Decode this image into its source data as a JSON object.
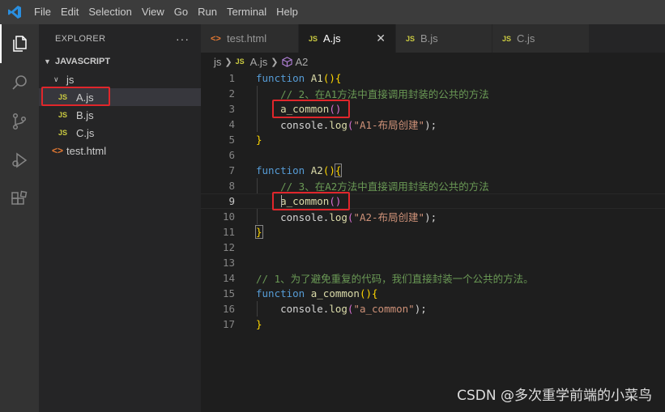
{
  "menu": [
    "File",
    "Edit",
    "Selection",
    "View",
    "Go",
    "Run",
    "Terminal",
    "Help"
  ],
  "sidebar": {
    "title": "EXPLORER",
    "more": "···",
    "root": "JAVASCRIPT",
    "folder": "js",
    "files": [
      {
        "badge": "JS",
        "name": "A.js"
      },
      {
        "badge": "JS",
        "name": "B.js"
      },
      {
        "badge": "JS",
        "name": "C.js"
      }
    ],
    "html_file": {
      "badge": "<>",
      "name": "test.html"
    }
  },
  "tabs": [
    {
      "badge": "<>",
      "name": "test.html"
    },
    {
      "badge": "JS",
      "name": "A.js",
      "close": "✕"
    },
    {
      "badge": "JS",
      "name": "B.js"
    },
    {
      "badge": "JS",
      "name": "C.js"
    }
  ],
  "breadcrumb": {
    "folder": "js",
    "file_badge": "JS",
    "file": "A.js",
    "symbol": "A2"
  },
  "code_lines": [
    {
      "n": "1"
    },
    {
      "n": "2"
    },
    {
      "n": "3"
    },
    {
      "n": "4"
    },
    {
      "n": "5"
    },
    {
      "n": "6"
    },
    {
      "n": "7"
    },
    {
      "n": "8"
    },
    {
      "n": "9"
    },
    {
      "n": "10"
    },
    {
      "n": "11"
    },
    {
      "n": "12"
    },
    {
      "n": "13"
    },
    {
      "n": "14"
    },
    {
      "n": "15"
    },
    {
      "n": "16"
    },
    {
      "n": "17"
    }
  ],
  "code": {
    "l1_kw": "function",
    "l1_fn": "A1",
    "l1_p1": "()",
    "l1_b": "{",
    "l2_cm": "// 2、在A1方法中直接调用封装的公共的方法",
    "l3_fn": "a_common",
    "l3_p": "()",
    "l4_obj": "console.",
    "l4_fn": "log",
    "l4_p1": "(",
    "l4_str": "\"A1-布局创建\"",
    "l4_p2": ");",
    "l5_b": "}",
    "l7_kw": "function",
    "l7_fn": "A2",
    "l7_p1": "()",
    "l7_b": "{",
    "l8_cm": "// 3、在A2方法中直接调用封装的公共的方法",
    "l9_fn": "a_common",
    "l9_p": "()",
    "l10_obj": "console.",
    "l10_fn": "log",
    "l10_p1": "(",
    "l10_str": "\"A2-布局创建\"",
    "l10_p2": ");",
    "l11_b": "}",
    "l14_cm": "// 1、为了避免重复的代码，我们直接封装一个公共的方法。",
    "l15_kw": "function",
    "l15_fn": "a_common",
    "l15_p1": "()",
    "l15_b": "{",
    "l16_obj": "console.",
    "l16_fn": "log",
    "l16_p1": "(",
    "l16_str": "\"a_common\"",
    "l16_p2": ");",
    "l17_b": "}"
  },
  "watermark": "CSDN @多次重学前端的小菜鸟",
  "colors": {
    "highlight_box": "#e0262b",
    "keyword": "#569cd6",
    "function": "#dcdcaa",
    "comment": "#6a9955",
    "string": "#ce9178",
    "js_badge": "#cbcb41"
  }
}
